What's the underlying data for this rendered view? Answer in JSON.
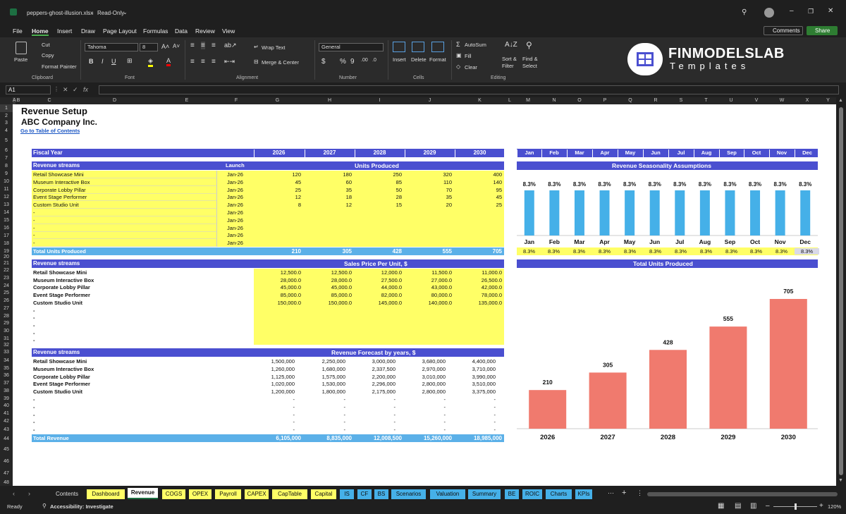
{
  "titlebar": {
    "filename": "peppers-ghost-illusion.xlsx",
    "mode": "Read-Only"
  },
  "menu": [
    "File",
    "Home",
    "Insert",
    "Draw",
    "Page Layout",
    "Formulas",
    "Data",
    "Review",
    "View"
  ],
  "menu_right": {
    "comments": "Comments",
    "share": "Share"
  },
  "ribbon": {
    "paste": "Paste",
    "cut": "Cut",
    "copy": "Copy",
    "format_painter": "Format Painter",
    "clipboard": "Clipboard",
    "font_name": "Tahoma",
    "font_size": "8",
    "font": "Font",
    "wrap_text": "Wrap Text",
    "merge_center": "Merge & Center",
    "alignment": "Alignment",
    "number_format": "General",
    "number": "Number",
    "insert": "Insert",
    "delete": "Delete",
    "format": "Format",
    "cells": "Cells",
    "autosum": "AutoSum",
    "fill": "Fill",
    "clear": "Clear",
    "sort_filter": "Sort &\nFilter",
    "find_select": "Find &\nSelect",
    "editing": "Editing",
    "brand_title": "FINMODELSLAB",
    "brand_sub": "Templates"
  },
  "formula_bar": {
    "name_box": "A1",
    "formula": ""
  },
  "columns": [
    "A",
    "B",
    "C",
    "D",
    "E",
    "F",
    "G",
    "H",
    "I",
    "J",
    "K",
    "L",
    "M",
    "N",
    "O",
    "P",
    "Q",
    "R",
    "S",
    "T",
    "U",
    "V",
    "W",
    "X",
    "Y"
  ],
  "rows": [
    "1",
    "2",
    "3",
    "4",
    "5",
    "6",
    "7",
    "8",
    "9",
    "10",
    "11",
    "12",
    "13",
    "14",
    "15",
    "16",
    "17",
    "18",
    "19",
    "20",
    "21",
    "22",
    "23",
    "24",
    "25",
    "26",
    "27",
    "28",
    "29",
    "30",
    "31",
    "32",
    "33",
    "34",
    "35",
    "36",
    "37",
    "38",
    "39",
    "40",
    "41",
    "42",
    "43",
    "44",
    "45",
    "46",
    "47",
    "48"
  ],
  "sheet": {
    "title": "Revenue Setup",
    "company": "ABC Company Inc.",
    "toc_link": "Go to Table of Contents",
    "fiscal_year_label": "Fiscal Year",
    "years": [
      "2026",
      "2027",
      "2028",
      "2029",
      "2030"
    ],
    "months": [
      "Jan",
      "Feb",
      "Mar",
      "Apr",
      "May",
      "Jun",
      "Jul",
      "Aug",
      "Sep",
      "Oct",
      "Nov",
      "Dec"
    ],
    "units": {
      "header": "Revenue streams",
      "launch_header": "Launch",
      "title": "Units Produced",
      "rows": [
        {
          "name": "Retail Showcase Mini",
          "launch": "Jan-26",
          "values": [
            "120",
            "180",
            "250",
            "320",
            "400"
          ]
        },
        {
          "name": "Museum Interactive Box",
          "launch": "Jan-26",
          "values": [
            "45",
            "60",
            "85",
            "110",
            "140"
          ]
        },
        {
          "name": "Corporate Lobby Pillar",
          "launch": "Jan-26",
          "values": [
            "25",
            "35",
            "50",
            "70",
            "95"
          ]
        },
        {
          "name": "Event Stage Performer",
          "launch": "Jan-26",
          "values": [
            "12",
            "18",
            "28",
            "35",
            "45"
          ]
        },
        {
          "name": "Custom Studio Unit",
          "launch": "Jan-26",
          "values": [
            "8",
            "12",
            "15",
            "20",
            "25"
          ]
        },
        {
          "name": "-",
          "launch": "Jan-26",
          "values": [
            "",
            "",
            "",
            "",
            ""
          ]
        },
        {
          "name": "-",
          "launch": "Jan-26",
          "values": [
            "",
            "",
            "",
            "",
            ""
          ]
        },
        {
          "name": "-",
          "launch": "Jan-26",
          "values": [
            "",
            "",
            "",
            "",
            ""
          ]
        },
        {
          "name": "-",
          "launch": "Jan-26",
          "values": [
            "",
            "",
            "",
            "",
            ""
          ]
        },
        {
          "name": "-",
          "launch": "Jan-26",
          "values": [
            "",
            "",
            "",
            "",
            ""
          ]
        }
      ],
      "total_label": "Total Units Produced",
      "totals": [
        "210",
        "305",
        "428",
        "555",
        "705"
      ]
    },
    "price": {
      "header": "Revenue streams",
      "title": "Sales Price Per Unit, $",
      "rows": [
        {
          "name": "Retail Showcase Mini",
          "values": [
            "12,500.0",
            "12,500.0",
            "12,000.0",
            "11,500.0",
            "11,000.0"
          ]
        },
        {
          "name": "Museum Interactive Box",
          "values": [
            "28,000.0",
            "28,000.0",
            "27,500.0",
            "27,000.0",
            "26,500.0"
          ]
        },
        {
          "name": "Corporate Lobby Pillar",
          "values": [
            "45,000.0",
            "45,000.0",
            "44,000.0",
            "43,000.0",
            "42,000.0"
          ]
        },
        {
          "name": "Event Stage Performer",
          "values": [
            "85,000.0",
            "85,000.0",
            "82,000.0",
            "80,000.0",
            "78,000.0"
          ]
        },
        {
          "name": "Custom Studio Unit",
          "values": [
            "150,000.0",
            "150,000.0",
            "145,000.0",
            "140,000.0",
            "135,000.0"
          ]
        },
        {
          "name": "-",
          "values": [
            "",
            "",
            "",
            "",
            ""
          ]
        },
        {
          "name": "-",
          "values": [
            "",
            "",
            "",
            "",
            ""
          ]
        },
        {
          "name": "-",
          "values": [
            "",
            "",
            "",
            "",
            ""
          ]
        },
        {
          "name": "-",
          "values": [
            "",
            "",
            "",
            "",
            ""
          ]
        },
        {
          "name": "-",
          "values": [
            "",
            "",
            "",
            "",
            ""
          ]
        }
      ]
    },
    "revenue": {
      "header": "Revenue streams",
      "title": "Revenue Forecast by years, $",
      "rows": [
        {
          "name": "Retail Showcase Mini",
          "values": [
            "1,500,000",
            "2,250,000",
            "3,000,000",
            "3,680,000",
            "4,400,000"
          ]
        },
        {
          "name": "Museum Interactive Box",
          "values": [
            "1,260,000",
            "1,680,000",
            "2,337,500",
            "2,970,000",
            "3,710,000"
          ]
        },
        {
          "name": "Corporate Lobby Pillar",
          "values": [
            "1,125,000",
            "1,575,000",
            "2,200,000",
            "3,010,000",
            "3,990,000"
          ]
        },
        {
          "name": "Event Stage Performer",
          "values": [
            "1,020,000",
            "1,530,000",
            "2,296,000",
            "2,800,000",
            "3,510,000"
          ]
        },
        {
          "name": "Custom Studio Unit",
          "values": [
            "1,200,000",
            "1,800,000",
            "2,175,000",
            "2,800,000",
            "3,375,000"
          ]
        },
        {
          "name": "-",
          "values": [
            "-",
            "-",
            "-",
            "-",
            "-"
          ]
        },
        {
          "name": "-",
          "values": [
            "-",
            "-",
            "-",
            "-",
            "-"
          ]
        },
        {
          "name": "-",
          "values": [
            "-",
            "-",
            "-",
            "-",
            "-"
          ]
        },
        {
          "name": "-",
          "values": [
            "-",
            "-",
            "-",
            "-",
            "-"
          ]
        },
        {
          "name": "-",
          "values": [
            "-",
            "-",
            "-",
            "-",
            "-"
          ]
        }
      ],
      "total_label": "Total Revenue",
      "totals": [
        "6,105,000",
        "8,835,000",
        "12,008,500",
        "15,260,000",
        "18,985,000"
      ]
    },
    "seasonality_title": "Revenue Seasonality Assumptions",
    "seasonality_pct": [
      "8.3%",
      "8.3%",
      "8.3%",
      "8.3%",
      "8.3%",
      "8.3%",
      "8.3%",
      "8.3%",
      "8.3%",
      "8.3%",
      "8.3%",
      "8.3%"
    ],
    "units_chart_title": "Total Units Produced"
  },
  "chart_data": [
    {
      "type": "bar",
      "title": "Revenue Seasonality Assumptions",
      "categories": [
        "Jan",
        "Feb",
        "Mar",
        "Apr",
        "May",
        "Jun",
        "Jul",
        "Aug",
        "Sep",
        "Oct",
        "Nov",
        "Dec"
      ],
      "values": [
        8.3,
        8.3,
        8.3,
        8.3,
        8.3,
        8.3,
        8.3,
        8.3,
        8.3,
        8.3,
        8.3,
        8.3
      ],
      "color": "#45b0e8"
    },
    {
      "type": "bar",
      "title": "Total Units Produced",
      "categories": [
        "2026",
        "2027",
        "2028",
        "2029",
        "2030"
      ],
      "values": [
        210,
        305,
        428,
        555,
        705
      ],
      "color": "#f07a6e"
    }
  ],
  "tabs": [
    {
      "label": "Contents",
      "color": "#1f1f1f",
      "text": "#ddd"
    },
    {
      "label": "Dashboard",
      "color": "#ffff66",
      "text": "#111"
    },
    {
      "label": "Revenue",
      "color": "#ffffff",
      "text": "#111",
      "active": true
    },
    {
      "label": "COGS",
      "color": "#ffff66",
      "text": "#111"
    },
    {
      "label": "OPEX",
      "color": "#ffff66",
      "text": "#111"
    },
    {
      "label": "Payroll",
      "color": "#ffff66",
      "text": "#111"
    },
    {
      "label": "CAPEX",
      "color": "#ffff66",
      "text": "#111"
    },
    {
      "label": "CapTable",
      "color": "#ffff66",
      "text": "#111"
    },
    {
      "label": "Capital",
      "color": "#ffff66",
      "text": "#111"
    },
    {
      "label": "IS",
      "color": "#45b0e8",
      "text": "#111"
    },
    {
      "label": "CF",
      "color": "#45b0e8",
      "text": "#111"
    },
    {
      "label": "BS",
      "color": "#45b0e8",
      "text": "#111"
    },
    {
      "label": "Scenarios",
      "color": "#45b0e8",
      "text": "#111"
    },
    {
      "label": "Valuation",
      "color": "#45b0e8",
      "text": "#111"
    },
    {
      "label": "Summary",
      "color": "#45b0e8",
      "text": "#111"
    },
    {
      "label": "BE",
      "color": "#45b0e8",
      "text": "#111"
    },
    {
      "label": "ROIC",
      "color": "#45b0e8",
      "text": "#111"
    },
    {
      "label": "Charts",
      "color": "#45b0e8",
      "text": "#111"
    },
    {
      "label": "KPIs",
      "color": "#45b0e8",
      "text": "#111"
    }
  ],
  "status": {
    "ready": "Ready",
    "accessibility": "Accessibility: Investigate",
    "zoom": "120%"
  }
}
